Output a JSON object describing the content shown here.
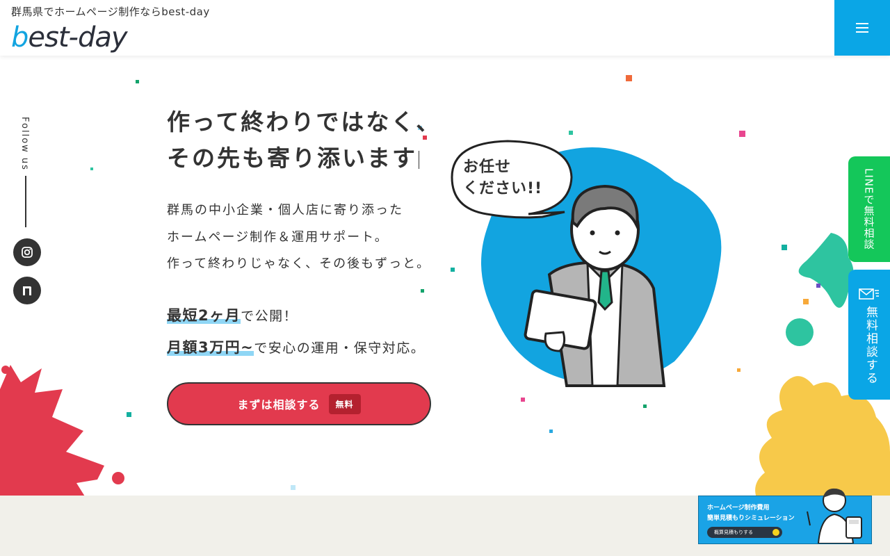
{
  "header": {
    "tagline": "群馬県でホームページ制作ならbest-day",
    "logo_b": "b",
    "logo_rest": "est-day"
  },
  "follow": {
    "label": "Follow us"
  },
  "hero": {
    "headline_line1": "作って終わりではなく、",
    "headline_line2": "その先も寄り添います",
    "lead_line1": "群馬の中小企業・個人店に寄り添った",
    "lead_line2": "ホームページ制作＆運用サポート。",
    "lead_line3": "作って終わりじゃなく、その後もずっと。",
    "point1_strong": "最短2ヶ月",
    "point1_rest": "で公開！",
    "point2_strong": "月額3万円~",
    "point2_rest": "で安心の運用・保守対応。",
    "cta_label": "まずは相談する",
    "cta_badge": "無料",
    "speech_line1": "お任せ",
    "speech_line2": "ください!!"
  },
  "side_tabs": {
    "line_label": "LINEで無料相談",
    "mail_label": "無料相談する"
  },
  "sim_banner": {
    "line1": "ホームページ制作費用",
    "line2": "簡単見積もりシミュレーション",
    "button": "概算見積もりする"
  },
  "icons": [
    "menu-icon",
    "instagram-icon",
    "note-icon",
    "mail-icon",
    "calculator-icon"
  ],
  "colors": {
    "accent_blue": "#0aa6e6",
    "cta_red": "#e23a4e",
    "line_green": "#14c75a",
    "splash_yellow": "#f7c94a"
  }
}
